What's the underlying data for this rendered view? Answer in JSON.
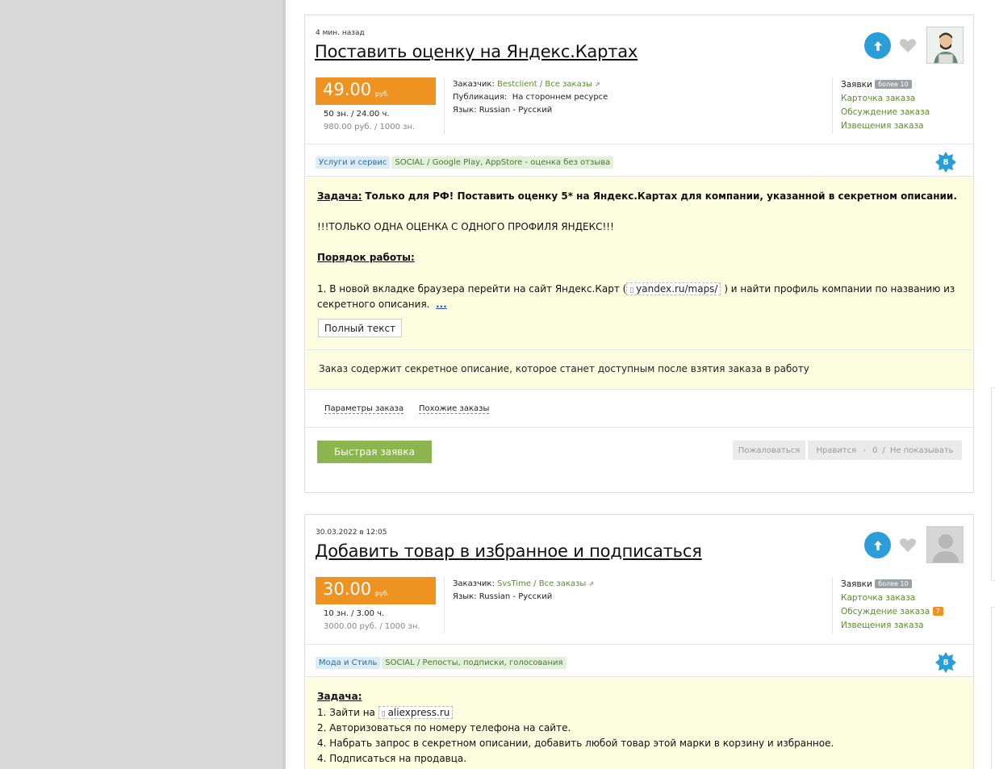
{
  "orders": [
    {
      "time": "4 мин. назад",
      "title": "Поставить оценку на Яндекс.Картах",
      "price": "49.00",
      "currency": "руб.",
      "price_line1": "50 зн.  /  24.00 ч.",
      "price_line2": "980.00 руб. / 1000 зн.",
      "customer_label": "Заказчик:",
      "customer_name": "Bestclient",
      "all_orders": "Все заказы",
      "publication_label": "Публикация:",
      "publication_value": "На стороннем ресурсе",
      "language_label": "Язык:",
      "language_value": "Russian - Русский",
      "links": {
        "bids": "Заявки",
        "bids_badge": "более 10",
        "card": "Карточка заказа",
        "discussion": "Обсуждение заказа",
        "notices": "Извещения заказа"
      },
      "tags": [
        "Услуги и сервис",
        "SOCIAL / Google Play, AppStore - оценка без отзыва"
      ],
      "star_number": "8",
      "task_label": "Задача:",
      "task_text": "Только для РФ! Поставить оценку 5* на Яндекс.Картах для компании, указанной в секретном описании.",
      "line_only_one": "!!!ТОЛЬКО ОДНА ОЦЕНКА С ОДНОГО ПРОФИЛЯ ЯНДЕКС!!!",
      "procedure_label": "Порядок работы:",
      "step1_a": "1. В новой вкладке браузера перейти на сайт Яндекс.Карт (",
      "step1_link": "yandex.ru/maps/",
      "step1_b": ") и найти профиль компании по названию из",
      "step1_c": "секретного описания.",
      "more_dots": "...",
      "full_text_button": "Полный текст",
      "secret_notice": "Заказ содержит секретное описание, которое станет доступным после взятия заказа в работу",
      "params_link": "Параметры заказа",
      "similar_link": "Похожие заказы",
      "quick_bid": "Быстрая заявка",
      "complain": "Пожаловаться",
      "like": "Нравится",
      "like_count": "0",
      "hide": "Не показывать"
    },
    {
      "time": "30.03.2022 в 12:05",
      "title": "Добавить товар в избранное и подписаться",
      "price": "30.00",
      "currency": "руб.",
      "price_line1": "10 зн.  /  3.00 ч.",
      "price_line2": "3000.00 руб. / 1000 зн.",
      "customer_label": "Заказчик:",
      "customer_name": "SvsTime",
      "all_orders": "Все заказы",
      "language_label": "Язык:",
      "language_value": "Russian - Русский",
      "links": {
        "bids": "Заявки",
        "bids_badge": "более 10",
        "card": "Карточка заказа",
        "discussion": "Обсуждение заказа",
        "discussion_badge": "7",
        "notices": "Извещения заказа"
      },
      "tags": [
        "Мода и Стиль",
        "SOCIAL / Репосты, подписки, голосования"
      ],
      "star_number": "8",
      "task_label": "Задача:",
      "step1_a": "1. Зайти на",
      "step1_link": "aliexpress.ru",
      "step2": "2. Авторизоваться по номеру телефона на сайте.",
      "step3": "4. Набрать запрос в секретном описании, добавить любой товар этой марки в корзину и избранное.",
      "step4": "4. Подписаться на продавца."
    }
  ]
}
